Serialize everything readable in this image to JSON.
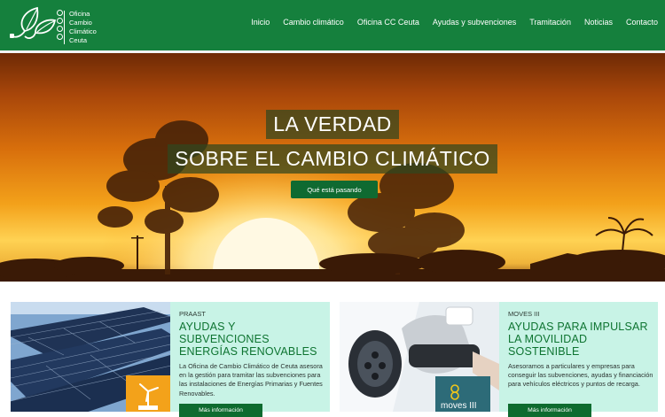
{
  "header": {
    "logo": {
      "lines": [
        "Oficina",
        "Cambio",
        "Climático",
        "Ceuta"
      ]
    },
    "nav": [
      {
        "label": "Inicio"
      },
      {
        "label": "Cambio climático"
      },
      {
        "label": "Oficina CC Ceuta"
      },
      {
        "label": "Ayudas y subvenciones"
      },
      {
        "label": "Tramitación"
      },
      {
        "label": "Noticias"
      },
      {
        "label": "Contacto"
      }
    ]
  },
  "hero": {
    "title_line1": "LA VERDAD",
    "title_line2": "SOBRE EL CAMBIO CLIMÁTICO",
    "button_label": "Qué está pasando"
  },
  "cards": [
    {
      "kicker": "PRAAST",
      "title_line1": "AYUDAS Y SUBVENCIONES",
      "title_line2": "ENERGÍAS RENOVABLES",
      "text": "La Oficina de Cambio Climático de Ceuta asesora en la gestión para tramitar las subvenciones para las instalaciones de Energías Primarias y Fuentes Renovables.",
      "button_label": "Más información"
    },
    {
      "kicker": "MOVES III",
      "title_line1": "AYUDAS PARA IMPULSAR",
      "title_line2": "LA MOVILIDAD SOSTENIBLE",
      "text": "Asesoramos a particulares y empresas para conseguir las subvenciones, ayudas y financiación para vehículos eléctricos y puntos de recarga.",
      "button_label": "Más información",
      "badge_text": "moves III"
    }
  ],
  "colors": {
    "header_green": "#15803d",
    "button_green": "#0e6b2f",
    "card_mint": "#c8f3e6",
    "title_green": "#0e7431"
  }
}
